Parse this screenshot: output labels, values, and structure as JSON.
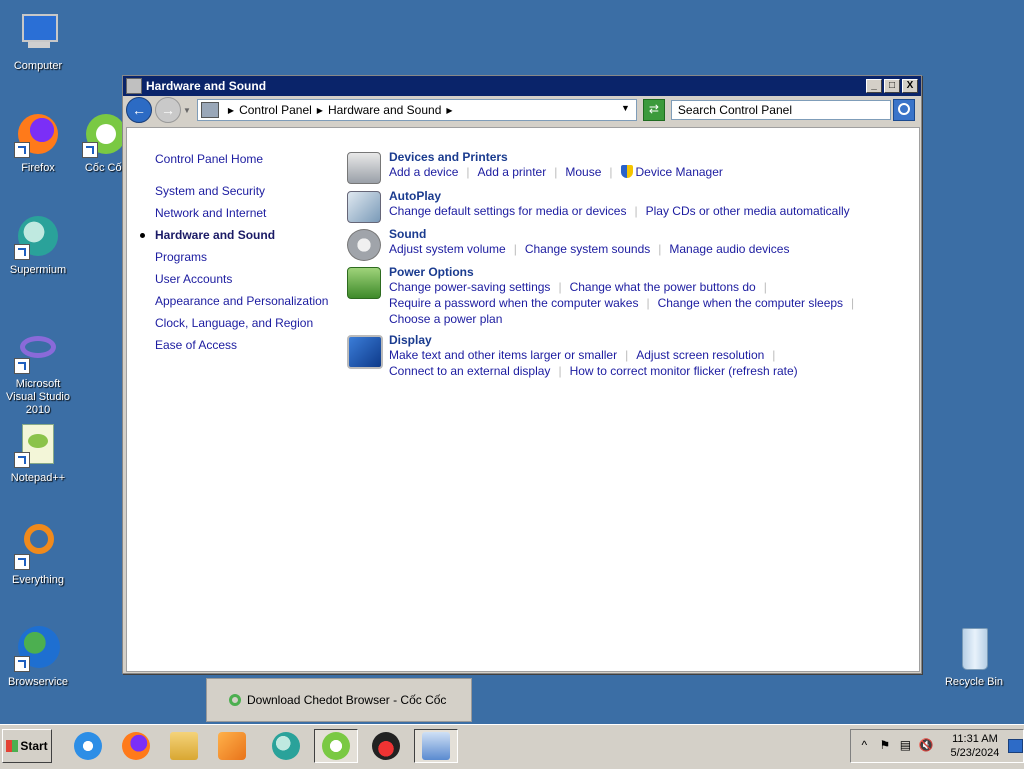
{
  "desktop": {
    "icons": [
      {
        "label": "Computer",
        "icon": "computer-icon"
      },
      {
        "label": "Firefox",
        "icon": "firefox-icon"
      },
      {
        "label": "Cốc Cốc",
        "icon": "coccoc-icon"
      },
      {
        "label": "Supermium",
        "icon": "supermium-icon"
      },
      {
        "label": "Microsoft Visual Studio 2010",
        "icon": "visual-studio-icon"
      },
      {
        "label": "Notepad++",
        "icon": "notepadpp-icon"
      },
      {
        "label": "Everything",
        "icon": "everything-icon"
      },
      {
        "label": "Browservice",
        "icon": "browservice-icon"
      },
      {
        "label": "Recycle Bin",
        "icon": "recycle-bin-icon"
      }
    ]
  },
  "window": {
    "title": "Hardware and Sound",
    "controls": {
      "minimize": "_",
      "maximize": "□",
      "close": "X"
    },
    "breadcrumb": [
      "Control Panel",
      "Hardware and Sound"
    ],
    "search_placeholder": "Search Control Panel"
  },
  "sidebar": {
    "items": [
      {
        "label": "Control Panel Home"
      },
      {
        "label": "System and Security"
      },
      {
        "label": "Network and Internet"
      },
      {
        "label": "Hardware and Sound",
        "active": true
      },
      {
        "label": "Programs"
      },
      {
        "label": "User Accounts"
      },
      {
        "label": "Appearance and Personalization"
      },
      {
        "label": "Clock, Language, and Region"
      },
      {
        "label": "Ease of Access"
      }
    ]
  },
  "categories": [
    {
      "title": "Devices and Printers",
      "icon": "printer-icon",
      "lines": [
        [
          "Add a device",
          "Add a printer",
          "Mouse",
          "Device Manager"
        ]
      ]
    },
    {
      "title": "AutoPlay",
      "icon": "autoplay-icon",
      "lines": [
        [
          "Change default settings for media or devices",
          "Play CDs or other media automatically"
        ]
      ]
    },
    {
      "title": "Sound",
      "icon": "speaker-icon",
      "lines": [
        [
          "Adjust system volume",
          "Change system sounds",
          "Manage audio devices"
        ]
      ]
    },
    {
      "title": "Power Options",
      "icon": "power-options-icon",
      "lines": [
        [
          "Change power-saving settings",
          "Change what the power buttons do"
        ],
        [
          "Require a password when the computer wakes",
          "Change when the computer sleeps"
        ],
        [
          "Choose a power plan"
        ]
      ]
    },
    {
      "title": "Display",
      "icon": "display-icon",
      "lines": [
        [
          "Make text and other items larger or smaller",
          "Adjust screen resolution"
        ],
        [
          "Connect to an external display",
          "How to correct monitor flicker (refresh rate)"
        ]
      ]
    }
  ],
  "popup": {
    "text": "Download Chedot Browser - Cốc Cốc"
  },
  "taskbar": {
    "start_label": "Start",
    "apps": [
      "internet-explorer-icon",
      "firefox-icon",
      "file-explorer-icon",
      "media-player-icon",
      "supermium-icon",
      "coccoc-icon",
      "angry-bird-icon",
      "control-panel-icon"
    ],
    "clock_time": "11:31 AM",
    "clock_date": "5/23/2024"
  }
}
